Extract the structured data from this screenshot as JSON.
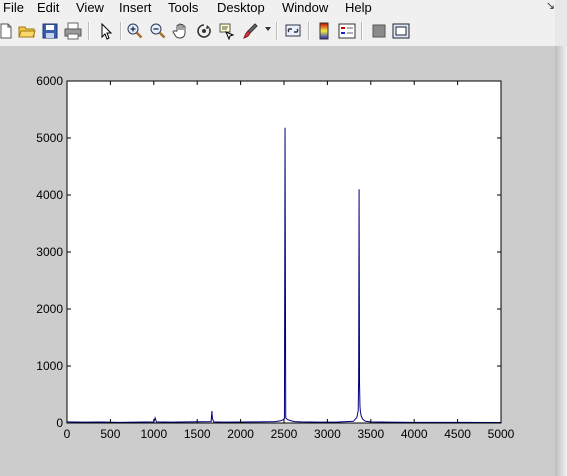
{
  "menu": {
    "items": [
      "File",
      "Edit",
      "View",
      "Insert",
      "Tools",
      "Desktop",
      "Window",
      "Help"
    ]
  },
  "toolbar": {
    "buttons": [
      "new-figure-icon",
      "open-file-icon",
      "save-icon",
      "print-icon",
      "pointer-icon",
      "zoom-in-icon",
      "zoom-out-icon",
      "pan-hand-icon",
      "rotate-3d-icon",
      "data-cursor-icon",
      "brush-icon",
      "link-plot-icon",
      "colorbar-icon",
      "legend-icon",
      "hide-plot-tools-icon",
      "show-plot-tools-icon"
    ]
  },
  "colors": {
    "figure_bg": "#cccccc",
    "axes_bg": "#ffffff",
    "line": "#00007f"
  },
  "chart_data": {
    "type": "line",
    "title": "",
    "xlabel": "",
    "ylabel": "",
    "xlim": [
      0,
      5000
    ],
    "ylim": [
      0,
      6000
    ],
    "xticks": [
      "0",
      "500",
      "1000",
      "1500",
      "2000",
      "2500",
      "3000",
      "3500",
      "4000",
      "4500",
      "5000"
    ],
    "yticks": [
      "0",
      "1000",
      "2000",
      "3000",
      "4000",
      "5000",
      "6000"
    ],
    "grid": false,
    "series": [
      {
        "color": "#00007f",
        "x": [
          0,
          200,
          400,
          600,
          800,
          1000,
          1010,
          1015,
          1030,
          1200,
          1400,
          1660,
          1670,
          1675,
          1690,
          1800,
          2000,
          2200,
          2400,
          2460,
          2490,
          2505,
          2512,
          2520,
          2540,
          2580,
          2620,
          2700,
          2900,
          3100,
          3300,
          3340,
          3355,
          3360,
          3365,
          3370,
          3375,
          3380,
          3390,
          3410,
          3440,
          3500,
          3700,
          4000,
          4300,
          4600,
          5000
        ],
        "y": [
          20,
          15,
          18,
          12,
          15,
          20,
          60,
          90,
          20,
          15,
          20,
          25,
          210,
          80,
          20,
          15,
          18,
          20,
          25,
          40,
          55,
          80,
          5180,
          90,
          60,
          40,
          25,
          20,
          15,
          15,
          30,
          100,
          220,
          780,
          4100,
          700,
          300,
          200,
          120,
          60,
          30,
          20,
          15,
          12,
          10,
          10,
          8
        ]
      }
    ]
  }
}
